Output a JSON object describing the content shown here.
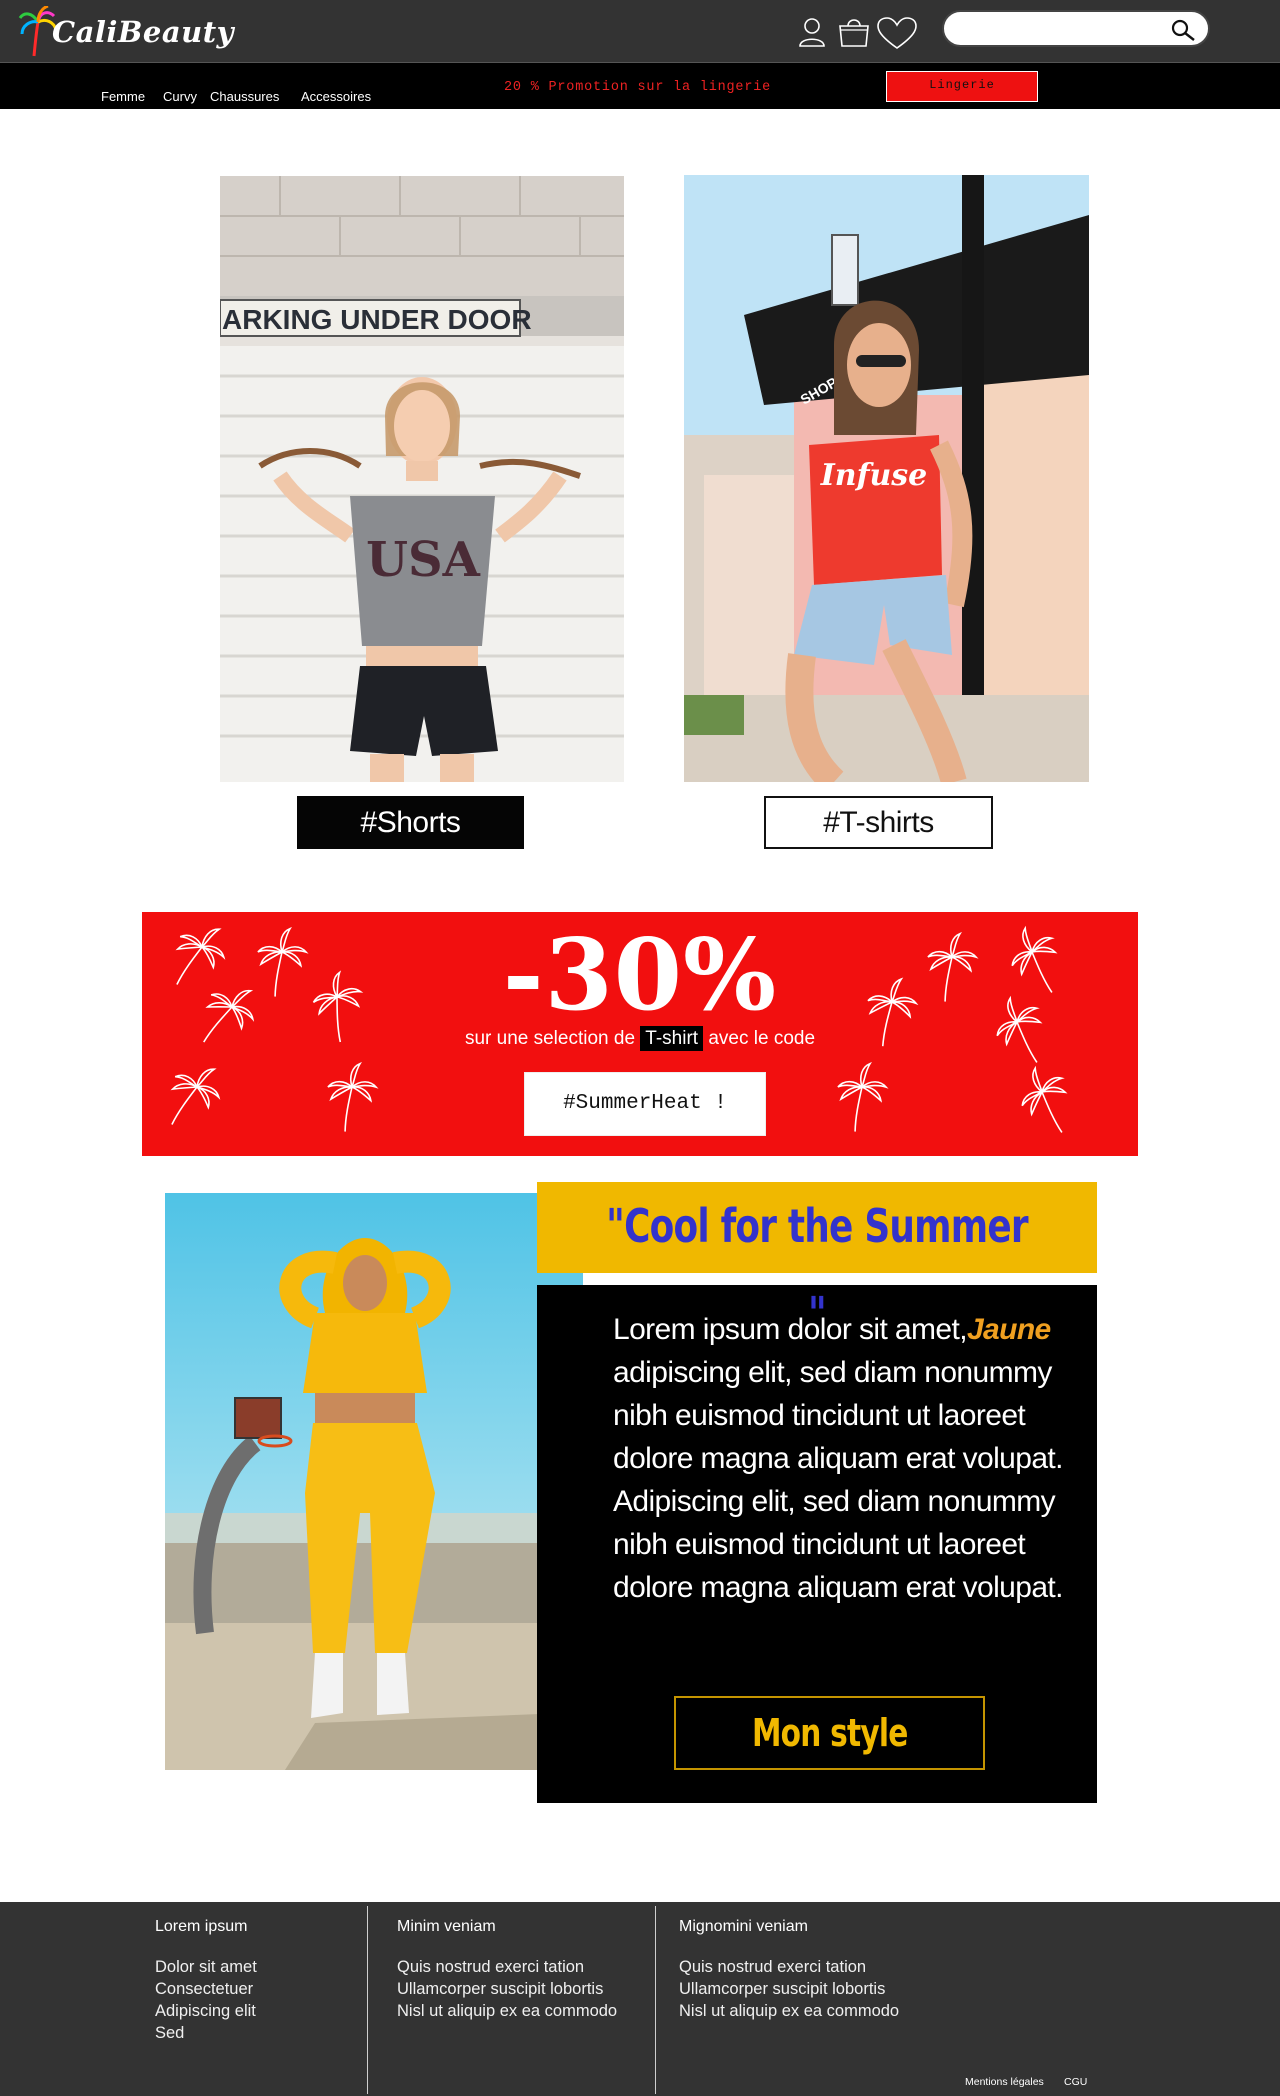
{
  "header": {
    "logo_text": "CaliBeauty",
    "search": {
      "value": "",
      "placeholder": ""
    },
    "icons": [
      "user-icon",
      "bag-icon",
      "heart-icon",
      "search-icon"
    ]
  },
  "nav": {
    "items": [
      "Femme",
      "Curvy",
      "Chaussures",
      "Accessoires"
    ],
    "promo_text": "20 % Promotion sur la lingerie",
    "promo_button": "Lingerie"
  },
  "products": [
    {
      "tag": "#Shorts",
      "style": "dark"
    },
    {
      "tag": "#T-shirts",
      "style": "light"
    }
  ],
  "photo_text": {
    "sign": "ARKING UNDER DOOR",
    "shirt_usa": "USA",
    "shirt_infuse": "Infuse",
    "store_sign": "SHOP BOUTIQUE"
  },
  "banner": {
    "discount": "-30%",
    "sub_before": "sur une selection de",
    "sub_highlight": "T-shirt",
    "sub_after": "avec le code",
    "code": "#SummerHeat !",
    "background": "#f20f0f"
  },
  "summer": {
    "title": "\"Cool for the Summer \"",
    "text_start": "Lorem ipsum dolor sit amet,",
    "text_highlight": "Jaune",
    "text_rest": "adipiscing elit, sed diam nonummy nibh euismod tincidunt ut laoreet dolore magna aliquam erat volupat. Adipiscing elit, sed diam nonummy nibh euismod tincidunt ut laoreet dolore magna aliquam erat volupat.",
    "button": "Mon style",
    "title_bg": "#f0b800",
    "title_color": "#3333cc"
  },
  "footer": {
    "columns": [
      {
        "heading": "Lorem ipsum",
        "links": [
          "Dolor sit amet",
          "Consectetuer",
          "Adipiscing elit",
          "Sed"
        ]
      },
      {
        "heading": "Minim veniam",
        "links": [
          "Quis nostrud exerci tation",
          "Ullamcorper suscipit lobortis",
          "Nisl ut aliquip ex ea commodo"
        ]
      },
      {
        "heading": "Mignomini veniam",
        "links": [
          "Quis nostrud exerci tation",
          "Ullamcorper suscipit lobortis",
          "Nisl ut aliquip ex ea commodo"
        ]
      }
    ],
    "legal": [
      "Mentions légales",
      "CGU"
    ]
  }
}
